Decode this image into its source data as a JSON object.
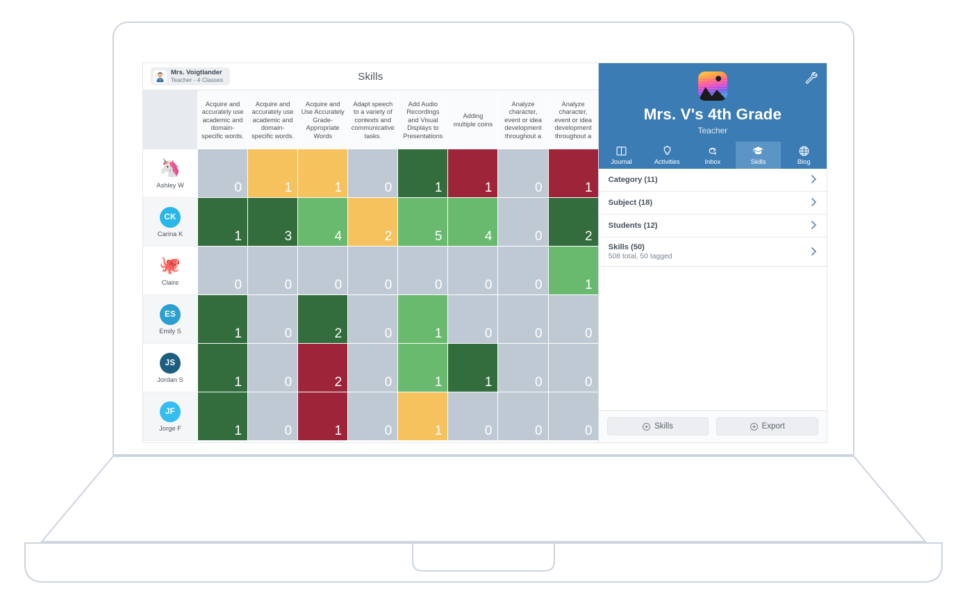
{
  "app": {
    "screen_title": "Skills",
    "profile": {
      "name": "Mrs. Voigtlander",
      "subtitle": "Teacher - 4 Classes",
      "avatar_icon": "person-avatar"
    }
  },
  "matrix": {
    "columns": [
      "Acquire and accurately use academic and domain-specific words.",
      "Acquire and accurately use academic and domain-specific words.",
      "Acquire and Use Accurately Grade-Appropriate Words",
      "Adapt speech to a variety of contexts and communicative tasks.",
      "Add Audio Recordings and Visual Displays to Presentations",
      "Adding multiple coins",
      "Analyze character, event or idea development throughout a",
      "Analyze character, event or idea development throughout a"
    ],
    "rows": [
      {
        "name": "Ashley W",
        "avatar_type": "emoji",
        "avatar": "🦄",
        "avatar_color": "",
        "values": [
          0,
          1,
          1,
          0,
          1,
          1,
          0,
          1
        ],
        "colors": [
          "gray",
          "amber",
          "amber",
          "gray",
          "dark-green",
          "crimson",
          "gray",
          "crimson"
        ]
      },
      {
        "name": "Carina K",
        "avatar_type": "initials",
        "avatar": "CK",
        "avatar_color": "#29b6e8",
        "values": [
          1,
          3,
          4,
          2,
          5,
          4,
          0,
          2
        ],
        "colors": [
          "dark-green",
          "dark-green",
          "light-green",
          "amber",
          "light-green",
          "light-green",
          "gray",
          "dark-green"
        ]
      },
      {
        "name": "Claire",
        "avatar_type": "emoji",
        "avatar": "🐙",
        "avatar_color": "",
        "values": [
          0,
          0,
          0,
          0,
          0,
          0,
          0,
          1
        ],
        "colors": [
          "gray",
          "gray",
          "gray",
          "gray",
          "gray",
          "gray",
          "gray",
          "light-green"
        ]
      },
      {
        "name": "Emily S",
        "avatar_type": "initials",
        "avatar": "ES",
        "avatar_color": "#2a9fd0",
        "values": [
          1,
          0,
          2,
          0,
          1,
          0,
          0,
          0
        ],
        "colors": [
          "dark-green",
          "gray",
          "dark-green",
          "gray",
          "light-green",
          "gray",
          "gray",
          "gray"
        ]
      },
      {
        "name": "Jordan S",
        "avatar_type": "initials",
        "avatar": "JS",
        "avatar_color": "#1d5e80",
        "values": [
          1,
          0,
          2,
          0,
          1,
          1,
          0,
          0
        ],
        "colors": [
          "dark-green",
          "gray",
          "crimson",
          "gray",
          "light-green",
          "dark-green",
          "gray",
          "gray"
        ]
      },
      {
        "name": "Jorge F",
        "avatar_type": "initials",
        "avatar": "JF",
        "avatar_color": "#36bdf0",
        "values": [
          1,
          0,
          1,
          0,
          1,
          0,
          0,
          0
        ],
        "colors": [
          "dark-green",
          "gray",
          "crimson",
          "gray",
          "amber",
          "gray",
          "gray",
          "gray"
        ]
      }
    ],
    "palette": {
      "gray": "#bfc9d4",
      "amber": "#f5c25e",
      "dark-green": "#336c3d",
      "light-green": "#69b96e",
      "crimson": "#9e2439"
    }
  },
  "sidebar": {
    "class_name": "Mrs. V's 4th Grade",
    "role": "Teacher",
    "logo_icon": "seesaw-logo-icon",
    "settings_icon": "wrench-icon",
    "tabs": [
      {
        "label": "Journal",
        "icon": "book-icon",
        "active": false
      },
      {
        "label": "Activities",
        "icon": "lightbulb-icon",
        "active": false
      },
      {
        "label": "Inbox",
        "icon": "chat-bubbles-icon",
        "active": false
      },
      {
        "label": "Skills",
        "icon": "graduation-cap-icon",
        "active": true
      },
      {
        "label": "Blog",
        "icon": "globe-icon",
        "active": false
      }
    ],
    "filters": [
      {
        "label": "Category (11)",
        "sub": ""
      },
      {
        "label": "Subject (18)",
        "sub": ""
      },
      {
        "label": "Students (12)",
        "sub": ""
      },
      {
        "label": "Skills (50)",
        "sub": "508 total, 50 tagged"
      }
    ],
    "footer_buttons": [
      {
        "label": "Skills",
        "icon": "plus-circle-icon"
      },
      {
        "label": "Export",
        "icon": "plus-circle-icon"
      }
    ],
    "accent_color": "#3c7cb4",
    "accent_active_color": "#5b95c6"
  }
}
